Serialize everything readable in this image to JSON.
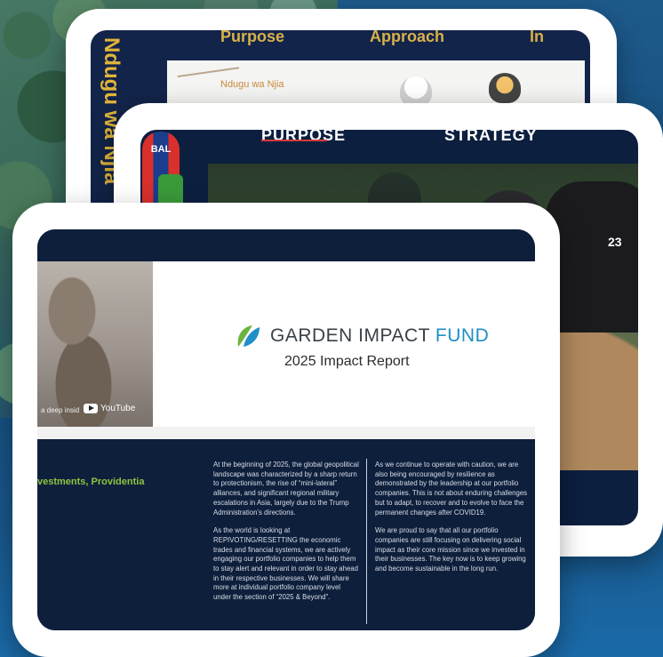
{
  "card_back": {
    "nav": [
      "Purpose",
      "Approach",
      "In"
    ],
    "side_title": "Ndugu wa Njia",
    "photo_tag": "Ndugu wa Njia"
  },
  "card_middle": {
    "nav_purpose": "PURPOSE",
    "nav_strategy": "STRATEGY",
    "badge": "BAL",
    "jersey_number": "23"
  },
  "card_front": {
    "brand_main": "GARDEN IMPACT",
    "brand_fund": "FUND",
    "subtitle": "2025 Impact Report",
    "video_caption": "a deep insid",
    "video_provider": "YouTube",
    "green_heading": "vestments, Providentia",
    "col_a": [
      "At the beginning of 2025, the global geopolitical landscape was characterized by a sharp return to protectionism, the rise of “mini-lateral” alliances, and significant regional military escalations in Asia, largely due to the Trump Administration’s directions.",
      "As the world is looking at REPIVOTING/RESETTING the economic trades and financial systems, we are actively engaging our portfolio companies to help them to stay alert and relevant in order to stay ahead in their respective businesses. We will share more at individual portfolio company level under the section of “2025 & Beyond”."
    ],
    "col_b": [
      "As we continue to operate with caution, we are also being encouraged by resilience as demonstrated by the leadership at our portfolio companies. This is not about enduring challenges but to adapt, to recover and to evolve to face the permanent changes after COVID19.",
      "We are proud to say that all our portfolio companies are still focusing on delivering social impact as their core mission since we invested in their businesses. The key now is to keep growing and become sustainable in the long run."
    ]
  },
  "colors": {
    "brand_blue": "#1f8fc6",
    "accent_green": "#8cc63f",
    "navy": "#0e1f3c"
  }
}
